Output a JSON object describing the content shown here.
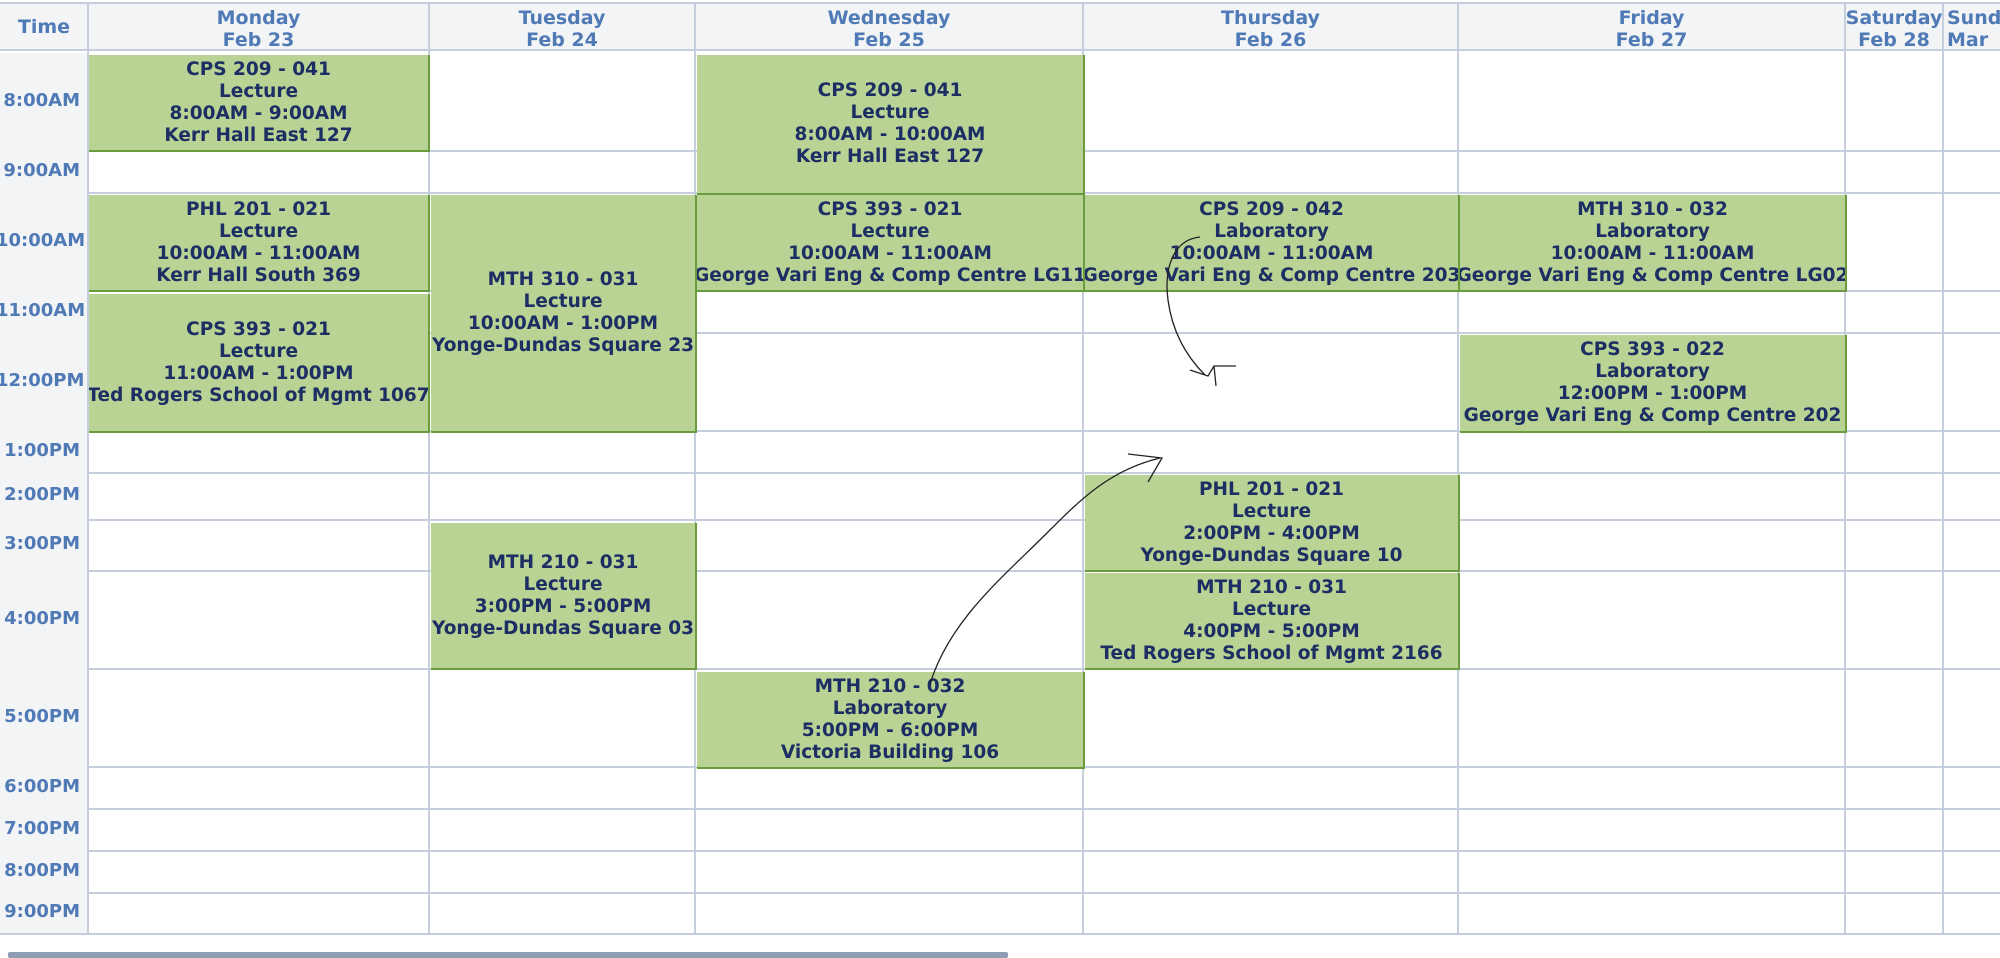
{
  "header": {
    "time_label": "Time",
    "days": [
      {
        "day": "Monday",
        "date": "Feb 23"
      },
      {
        "day": "Tuesday",
        "date": "Feb 24"
      },
      {
        "day": "Wednesday",
        "date": "Feb 25"
      },
      {
        "day": "Thursday",
        "date": "Feb 26"
      },
      {
        "day": "Friday",
        "date": "Feb 27"
      },
      {
        "day": "Saturday",
        "date": "Feb 28"
      },
      {
        "day": "Sunda",
        "date": "Mar"
      }
    ]
  },
  "times": [
    "8:00AM",
    "9:00AM",
    "10:00AM",
    "11:00AM",
    "12:00PM",
    "1:00PM",
    "2:00PM",
    "3:00PM",
    "4:00PM",
    "5:00PM",
    "6:00PM",
    "7:00PM",
    "8:00PM",
    "9:00PM"
  ],
  "events": [
    {
      "course": "CPS 209 - 041",
      "type": "Lecture",
      "time": "8:00AM - 9:00AM",
      "room": "Kerr Hall East 127"
    },
    {
      "course": "PHL 201 - 021",
      "type": "Lecture",
      "time": "10:00AM - 11:00AM",
      "room": "Kerr Hall South 369"
    },
    {
      "course": "CPS 393 - 021",
      "type": "Lecture",
      "time": "11:00AM - 1:00PM",
      "room": "Ted Rogers School of Mgmt 1067"
    },
    {
      "course": "MTH 310 - 031",
      "type": "Lecture",
      "time": "10:00AM - 1:00PM",
      "room": "Yonge-Dundas Square 23"
    },
    {
      "course": "MTH 210 - 031",
      "type": "Lecture",
      "time": "3:00PM - 5:00PM",
      "room": "Yonge-Dundas Square 03"
    },
    {
      "course": "CPS 209 - 041",
      "type": "Lecture",
      "time": "8:00AM - 10:00AM",
      "room": "Kerr Hall East 127"
    },
    {
      "course": "CPS 393 - 021",
      "type": "Lecture",
      "time": "10:00AM - 11:00AM",
      "room": "George Vari Eng & Comp Centre LG11"
    },
    {
      "course": "MTH 210 - 032",
      "type": "Laboratory",
      "time": "5:00PM - 6:00PM",
      "room": "Victoria Building 106"
    },
    {
      "course": "CPS 209 - 042",
      "type": "Laboratory",
      "time": "10:00AM - 11:00AM",
      "room": "George Vari Eng & Comp Centre 203"
    },
    {
      "course": "PHL 201 - 021",
      "type": "Lecture",
      "time": "2:00PM - 4:00PM",
      "room": "Yonge-Dundas Square 10"
    },
    {
      "course": "MTH 210 - 031",
      "type": "Lecture",
      "time": "4:00PM - 5:00PM",
      "room": "Ted Rogers School of Mgmt 2166"
    },
    {
      "course": "MTH 310 - 032",
      "type": "Laboratory",
      "time": "10:00AM - 11:00AM",
      "room": "George Vari Eng & Comp Centre LG02"
    },
    {
      "course": "CPS 393 - 022",
      "type": "Laboratory",
      "time": "12:00PM - 1:00PM",
      "room": "George Vari Eng & Comp Centre 202"
    }
  ],
  "colors": {
    "event_fill": "#b8d394",
    "event_border": "#6a9b3d",
    "event_text": "#1c2e63",
    "header_text": "#4f7ab6",
    "grid_line": "#c4cedd",
    "header_bg": "#f2f4f6"
  }
}
